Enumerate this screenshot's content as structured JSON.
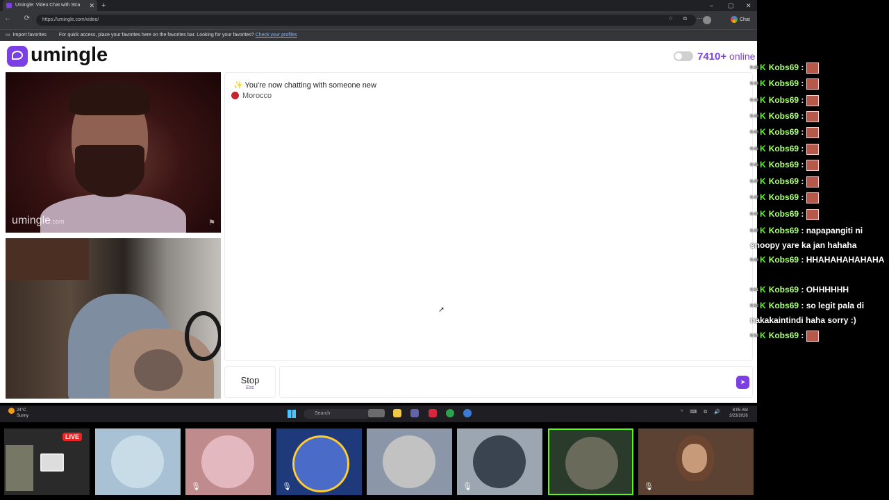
{
  "browser": {
    "tab_title": "Umingle: Video Chat with Stra",
    "tab_close": "✕",
    "new_tab": "+",
    "url": "https://umingle.com/video/",
    "nav_icons": "← ⟳",
    "address_icons": "☆ ⧉ ⋯",
    "chat_label": "Chat",
    "window_controls": {
      "min": "–",
      "max": "▢",
      "close": "✕"
    },
    "favorites": {
      "import": "Import favorites",
      "message": "For quick access, place your favorites here on the favorites bar. Looking for your favorites?",
      "link": "Check your profiles"
    }
  },
  "site": {
    "logo_text": "umingle",
    "online_count": "7410+",
    "online_label": "online",
    "video_watermark": "umingle",
    "video_watermark_suffix": ".com",
    "system_message": "✨ You're now chatting with someone new",
    "country": "Morocco",
    "stop_label": "Stop",
    "stop_key": "Esc",
    "message_placeholder": "",
    "send_icon": "➤",
    "colors": {
      "accent": "#7b3fe4",
      "flag_red": "#c1272d"
    }
  },
  "taskbar": {
    "temperature": "24°C",
    "weather": "Sunny",
    "search_placeholder": "Search",
    "tray_icons": "^ ⌨ ⧉ 🔊",
    "time": "8:05 AM",
    "date": "3/23/2026"
  },
  "stream_chat": [
    {
      "ts": "9:43",
      "user": "Kobs69",
      "text": ":",
      "emote": true
    },
    {
      "ts": "9:44",
      "user": "Kobs69",
      "text": ":",
      "emote": true
    },
    {
      "ts": "9:44",
      "user": "Kobs69",
      "text": ":",
      "emote": true
    },
    {
      "ts": "9:45",
      "user": "Kobs69",
      "text": ":",
      "emote": true
    },
    {
      "ts": "9:45",
      "user": "Kobs69",
      "text": ":",
      "emote": true
    },
    {
      "ts": "9:46",
      "user": "Kobs69",
      "text": ":",
      "emote": true
    },
    {
      "ts": "9:46",
      "user": "Kobs69",
      "text": ":",
      "emote": true
    },
    {
      "ts": "9:47",
      "user": "Kobs69",
      "text": ":",
      "emote": true
    },
    {
      "ts": "9:47",
      "user": "Kobs69",
      "text": ":",
      "emote": true
    },
    {
      "ts": "9:47",
      "user": "Kobs69",
      "text": ":",
      "emote": true
    },
    {
      "ts": "9:47",
      "user": "Kobs69",
      "text": ": napapangiti ni snoopy yare ka jan hahaha",
      "emote": false
    },
    {
      "ts": "9:48",
      "user": "Kobs69",
      "text": ": HHAHAHAHAHAHA",
      "emote": false
    },
    {
      "ts": "9:51",
      "user": "Kobs69",
      "text": ": OHHHHHH",
      "emote": false
    },
    {
      "ts": "9:52",
      "user": "Kobs69",
      "text": ": so legit pala di nakakaintindi haha sorry :)",
      "emote": false
    },
    {
      "ts": "9:54",
      "user": "Kobs69",
      "text": ":",
      "emote": true
    }
  ],
  "bottom_strip": {
    "live_badge": "LIVE",
    "tile_count": 8
  }
}
